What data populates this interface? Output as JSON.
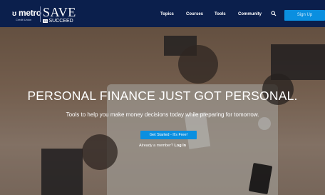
{
  "header": {
    "brand": "metro",
    "brand_sub": "Credit Union",
    "save": "SAVE",
    "to": "TO",
    "succeed": "SUCCEED",
    "nav": [
      "Topics",
      "Courses",
      "Tools",
      "Community"
    ],
    "signup_label": "Sign Up"
  },
  "hero": {
    "headline": "PERSONAL FINANCE JUST GOT PERSONAL.",
    "subheadline": "Tools to help you make money decisions today while preparing for tomorrow.",
    "cta_label": "Get Started - It's Free!",
    "login_text": "Already a member?",
    "login_link": "Log In"
  },
  "colors": {
    "header_bg": "#0b1f4c",
    "accent": "#0a8fe0"
  },
  "icons": {
    "search": "search-icon"
  }
}
